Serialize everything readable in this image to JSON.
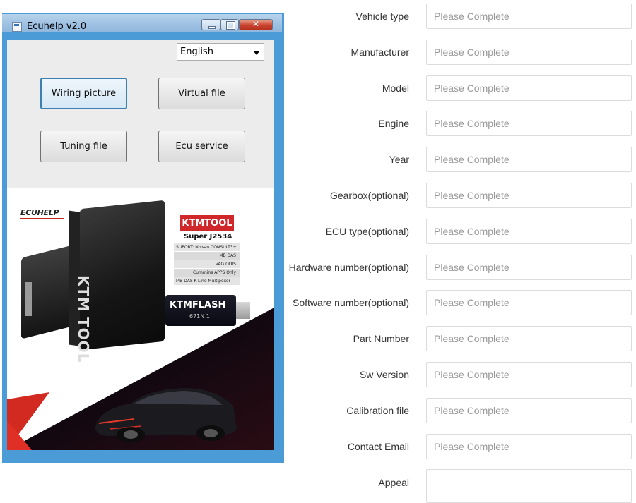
{
  "window": {
    "title": "Ecuhelp v2.0",
    "language_select": {
      "value": "English"
    },
    "buttons": [
      {
        "label": "Wiring picture",
        "selected": true
      },
      {
        "label": "Virtual file",
        "selected": false
      },
      {
        "label": "Tuning file",
        "selected": false
      },
      {
        "label": "Ecu service",
        "selected": false
      }
    ],
    "product_image": {
      "brand": "ECUHELP",
      "tool_brand": "KTMTOOL",
      "tool_model": "Super J2534",
      "support_list": [
        "SUPORT: Nissan CONSULT3+",
        "MB DAS",
        "VAG ODIS",
        "Cummins APPS Only",
        "MB DAS K-Line Multipexer"
      ],
      "device_mark": "KTM TOOL",
      "usb_brand": "KTMFLASH",
      "usb_model": "671N 1"
    }
  },
  "form": {
    "placeholder": "Please Complete",
    "fields": [
      {
        "label": "Vehicle type",
        "value": ""
      },
      {
        "label": "Manufacturer",
        "value": ""
      },
      {
        "label": "Model",
        "value": ""
      },
      {
        "label": "Engine",
        "value": ""
      },
      {
        "label": "Year",
        "value": ""
      },
      {
        "label": "Gearbox(optional)",
        "value": ""
      },
      {
        "label": "ECU type(optional)",
        "value": ""
      },
      {
        "label": "Hardware number(optional)",
        "value": ""
      },
      {
        "label": "Software number(optional)",
        "value": ""
      },
      {
        "label": "Part Number",
        "value": ""
      },
      {
        "label": "Sw Version",
        "value": ""
      },
      {
        "label": "Calibration file",
        "value": ""
      },
      {
        "label": "Contact Email",
        "value": ""
      }
    ],
    "appeal": {
      "label": "Appeal",
      "value": ""
    }
  },
  "colors": {
    "window_frame": "#4a9bd6",
    "close_button": "#c9432e",
    "ktm_red": "#d0272a",
    "selected_button_border": "#3c7fb1"
  }
}
